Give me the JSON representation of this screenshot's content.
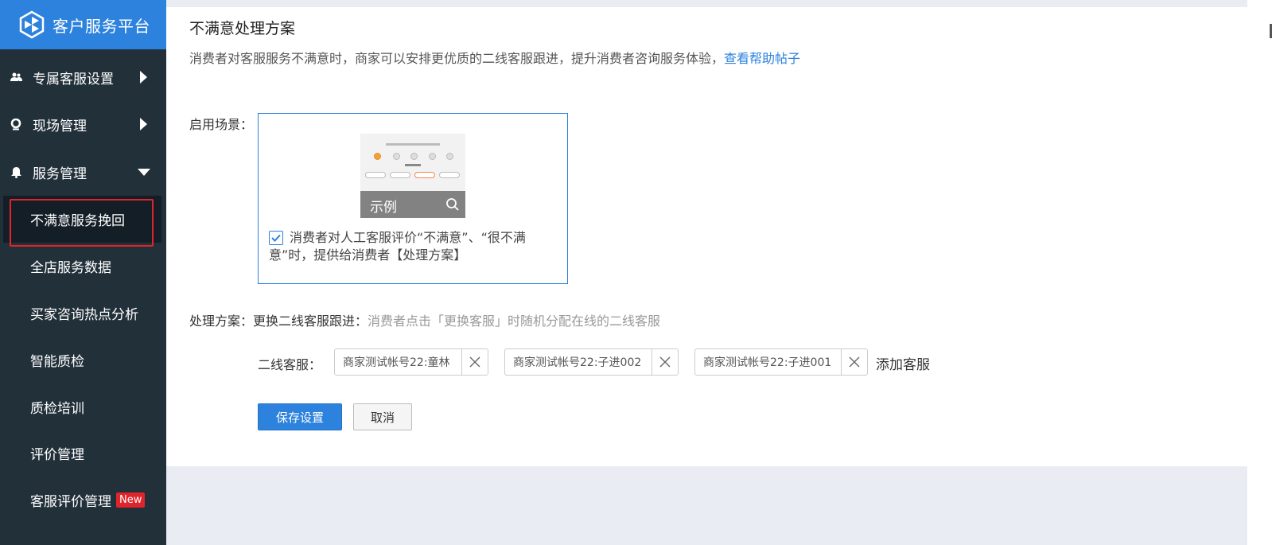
{
  "brand": {
    "title": "客户服务平台"
  },
  "sidebar": {
    "groups": [
      {
        "label": "专属客服设置",
        "icon": "users-icon"
      },
      {
        "label": "现场管理",
        "icon": "location-pin-icon"
      },
      {
        "label": "服务管理",
        "icon": "bell-icon"
      }
    ],
    "items": [
      {
        "label": "不满意服务挽回",
        "active": true
      },
      {
        "label": "全店服务数据"
      },
      {
        "label": "买家咨询热点分析"
      },
      {
        "label": "智能质检"
      },
      {
        "label": "质检培训"
      },
      {
        "label": "评价管理"
      },
      {
        "label": "客服评价管理",
        "badge": "New"
      }
    ]
  },
  "main": {
    "title": "不满意处理方案",
    "description": "消费者对客服服务不满意时，商家可以安排更优质的二线客服跟进，提升消费者咨询服务体验，",
    "help_link": "查看帮助帖子",
    "scene_label": "启用场景：",
    "example_label": "示例",
    "checkbox_text": "消费者对人工客服评价“不满意”、“很不满意”时，提供给消费者【处理方案】",
    "checkbox_checked": true,
    "plan_label": "处理方案：",
    "plan_value": "更换二线客服跟进：",
    "plan_hint": "消费者点击「更换客服」时随机分配在线的二线客服",
    "agents_label": "二线客服：",
    "agents": [
      "商家测试帐号22:童林",
      "商家测试帐号22:子进002",
      "商家测试帐号22:子进001"
    ],
    "add_agent": "添加客服",
    "save_button": "保存设置",
    "cancel_button": "取消"
  },
  "colors": {
    "brand_blue": "#2c82dd",
    "sidebar_bg": "#22303a",
    "highlight_red": "#e0242b"
  }
}
